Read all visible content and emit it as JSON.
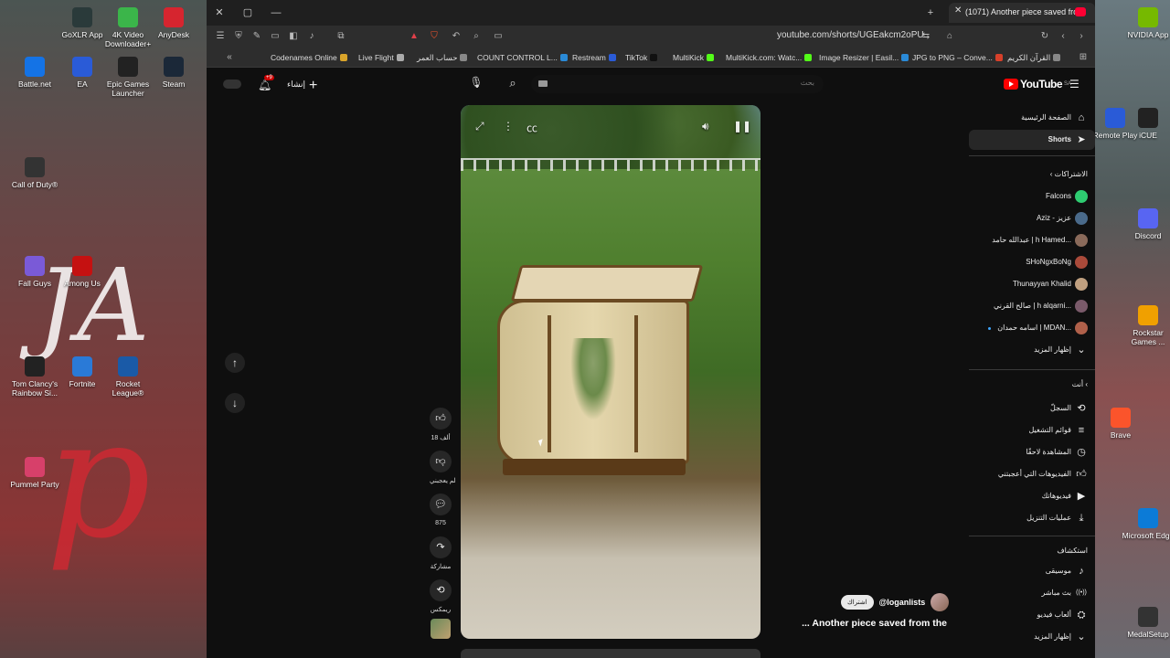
{
  "desktop": {
    "icons_left": [
      {
        "label": "GoXLR App",
        "icon": "goxlr-icon",
        "color": "#2a3a3a"
      },
      {
        "label": "4K Video Downloader+",
        "icon": "4k-video-icon",
        "color": "#3bb54a"
      },
      {
        "label": "AnyDesk",
        "icon": "anydesk-icon",
        "color": "#d6252f"
      },
      {
        "label": "Battle.net",
        "icon": "battlenet-icon",
        "color": "#1473e6"
      },
      {
        "label": "EA",
        "icon": "ea-icon",
        "color": "#2a5bd7"
      },
      {
        "label": "Epic Games Launcher",
        "icon": "epic-icon",
        "color": "#222222"
      },
      {
        "label": "Steam",
        "icon": "steam-icon",
        "color": "#1b2838"
      },
      {
        "label": "Call of Duty®",
        "icon": "cod-icon",
        "color": "#333333"
      },
      {
        "label": "Fall Guys",
        "icon": "fallguys-icon",
        "color": "#7a5ad7"
      },
      {
        "label": "Among Us",
        "icon": "amongus-icon",
        "color": "#c51111"
      },
      {
        "label": "Tom Clancy's Rainbow Si...",
        "icon": "rainbow-icon",
        "color": "#222222"
      },
      {
        "label": "Fortnite",
        "icon": "fortnite-icon",
        "color": "#2a7ad7"
      },
      {
        "label": "Rocket League®",
        "icon": "rocketleague-icon",
        "color": "#1a5aa7"
      },
      {
        "label": "Pummel Party",
        "icon": "pummel-icon",
        "color": "#d7406a"
      }
    ],
    "icons_right": [
      {
        "label": "NVIDIA App",
        "icon": "nvidia-icon",
        "color": "#76b900"
      },
      {
        "label": "Remote Play",
        "icon": "remoteplay-icon",
        "color": "#2a5bd7"
      },
      {
        "label": "iCUE",
        "icon": "icue-icon",
        "color": "#222222"
      },
      {
        "label": "Discord",
        "icon": "discord-icon",
        "color": "#5865f2"
      },
      {
        "label": "Rockstar Games ...",
        "icon": "rockstar-icon",
        "color": "#f0a000"
      },
      {
        "label": "Brave",
        "icon": "brave-icon",
        "color": "#fb542b"
      },
      {
        "label": "Microsoft Edge",
        "icon": "edge-icon",
        "color": "#0c7bd7"
      },
      {
        "label": "MedalSetup",
        "icon": "medal-icon",
        "color": "#333333"
      }
    ],
    "deco_letters": "JA"
  },
  "browser": {
    "tab_title": "(1071) Another piece saved from",
    "url": "youtube.com/shorts/UGEakcm2oPU",
    "bookmarks": [
      {
        "label": "Codenames Online",
        "color": "#d9a42a"
      },
      {
        "label": "Live Flight",
        "color": "#aaaaaa"
      },
      {
        "label": "حساب العمر",
        "color": "#888888"
      },
      {
        "label": "COUNT CONTROL L...",
        "color": "#2a8ad7"
      },
      {
        "label": "Restream",
        "color": "#2a5bd7"
      },
      {
        "label": "TikTok",
        "color": "#111111"
      },
      {
        "label": "MultiKick",
        "color": "#53fc18"
      },
      {
        "label": "MultiKick.com: Watc...",
        "color": "#53fc18"
      },
      {
        "label": "Image Resizer | Easil...",
        "color": "#2a8ad7"
      },
      {
        "label": "JPG to PNG – Conve...",
        "color": "#d7402a"
      },
      {
        "label": "القرآن الكريم",
        "color": "#888888"
      }
    ]
  },
  "youtube": {
    "create_label": "إنشاء",
    "notif_badge": "+9",
    "search_placeholder": "بحث",
    "logo_text": "YouTube",
    "logo_country": "SA",
    "actions": {
      "likes": "18 ألف",
      "dislike_label": "لم يعجبني",
      "comments": "875",
      "share_label": "مشاركة",
      "remix_label": "ريمكس"
    },
    "channel_name": "@loganlists",
    "subscribe_label": "اشتراك",
    "video_title": "... Another piece saved from the",
    "sidebar": {
      "home": "الصفحة الرئيسية",
      "shorts": "Shorts",
      "subscriptions_header": "الاشتراكات",
      "channels": [
        {
          "name": "Falcons",
          "color": "#2ecc71"
        },
        {
          "name": "Aziz - عزيز",
          "color": "#4a6a8a"
        },
        {
          "name": "عبدالله حامد | h Hamed...",
          "color": "#8a6a5a"
        },
        {
          "name": "SHoNgxBoNg",
          "color": "#aa4a3a"
        },
        {
          "name": "Thunayyan Khalid",
          "color": "#c0a080"
        },
        {
          "name": "صالح القرني | h alqarni...",
          "color": "#7a5a6a"
        },
        {
          "name": "اسامه حمدان | MDAN...",
          "color": "#b0604a"
        }
      ],
      "show_more_subs": "إظهار المزيد",
      "you_header": "أنت",
      "you_items": [
        {
          "label": "السجلّ",
          "icon": "history-icon"
        },
        {
          "label": "قوائم التشغيل",
          "icon": "playlists-icon"
        },
        {
          "label": "المشاهدة لاحقًا",
          "icon": "watch-later-icon"
        },
        {
          "label": "الفيديوهات التي أعجبتني",
          "icon": "liked-icon"
        },
        {
          "label": "فيديوهاتك",
          "icon": "your-videos-icon"
        },
        {
          "label": "عمليات التنزيل",
          "icon": "downloads-icon"
        }
      ],
      "explore_header": "استكشاف",
      "explore_items": [
        {
          "label": "موسيقى",
          "icon": "music-icon"
        },
        {
          "label": "بث مباشر",
          "icon": "live-icon"
        },
        {
          "label": "ألعاب فيديو",
          "icon": "gaming-icon"
        }
      ],
      "show_more_explore": "إظهار المزيد"
    }
  }
}
